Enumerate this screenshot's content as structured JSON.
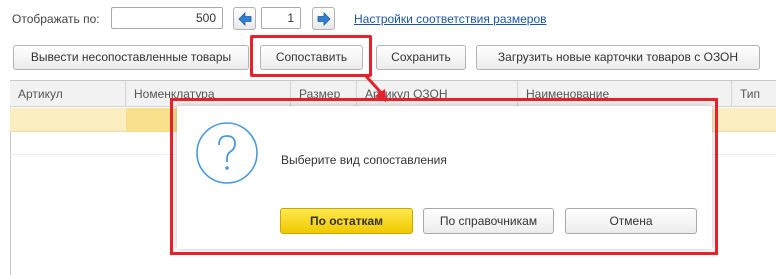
{
  "toolbar_top": {
    "show_label": "Отображать по:",
    "show_count": "500",
    "page_number": "1",
    "size_settings_link": "Настройки соответствия размеров"
  },
  "actions": {
    "unmatched_label": "Вывести несопоставленные товары",
    "match_label": "Сопоставить",
    "save_label": "Сохранить",
    "load_label": "Загрузить новые карточки товаров с ОЗОН"
  },
  "grid": {
    "columns": [
      "Артикул",
      "Номенклатура",
      "Размер",
      "Артикул ОЗОН",
      "Наименование",
      "Тип"
    ]
  },
  "dialog": {
    "message": "Выберите вид сопоставления",
    "by_stock_label": "По остаткам",
    "by_reference_label": "По справочникам",
    "cancel_label": "Отмена"
  },
  "colors": {
    "highlight": "#e8202a",
    "primary_button": "#f5d400",
    "selected_row": "#fbeec1",
    "link": "#1a55a8"
  }
}
